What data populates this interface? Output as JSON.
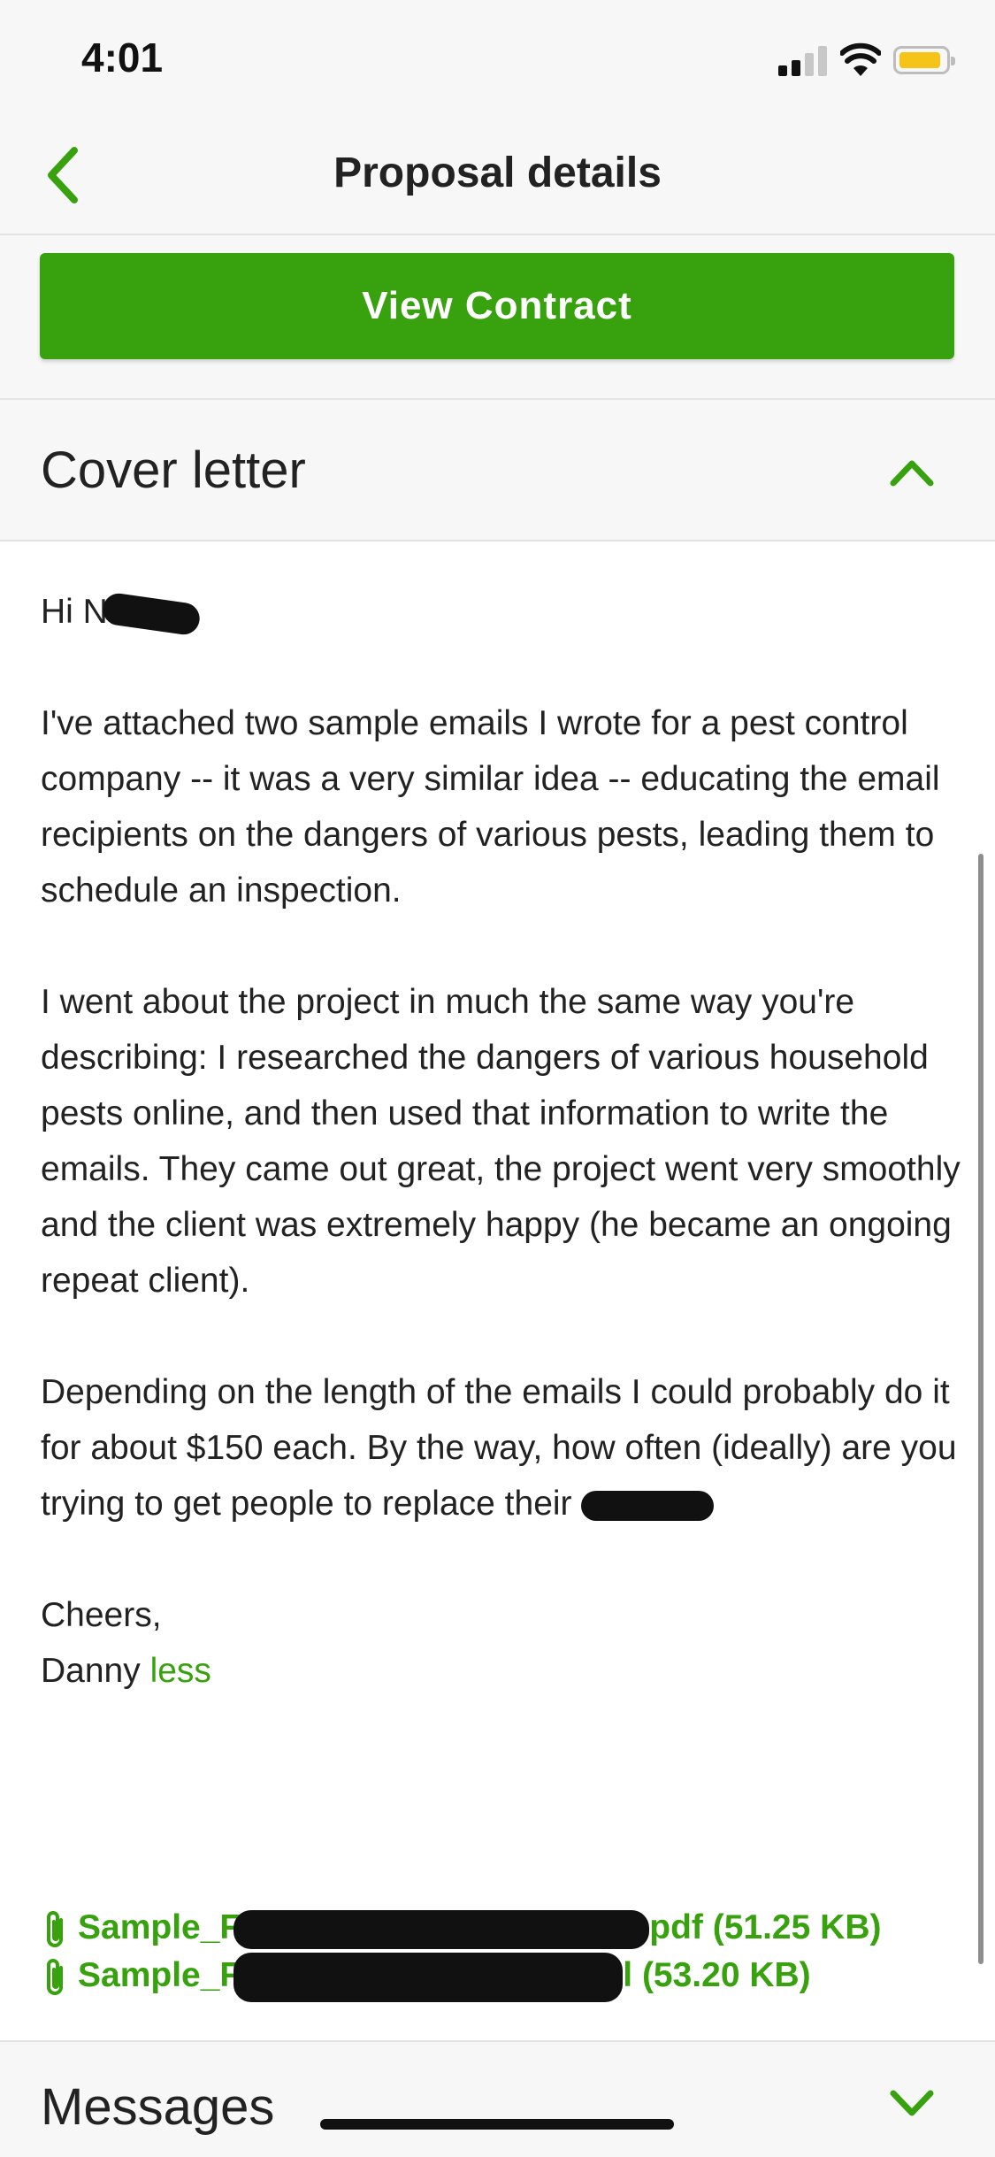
{
  "status_bar": {
    "time": "4:01",
    "icons": [
      "cellular-signal-icon",
      "wifi-icon",
      "battery-icon"
    ]
  },
  "nav": {
    "title": "Proposal details",
    "back_icon": "chevron-left-icon"
  },
  "contract_button": {
    "label": "View Contract"
  },
  "cover_letter": {
    "title": "Cover letter",
    "greeting": "Hi N",
    "paragraph_1": "I've attached two sample emails I wrote for a pest control company -- it was a very similar idea -- educating the email recipients on the dangers of various pests, leading them to schedule an inspection.",
    "paragraph_2": "I went about the project in much the same way you're describing: I researched the dangers of various household pests online, and then used that information to write the emails. They came out great, the project went very smoothly and the client was extremely happy (he became an ongoing repeat client).",
    "paragraph_3": "Depending on the length of the emails I could probably do it for about $150 each. By the way, how often (ideally) are you trying to get people to replace their",
    "sign_off": "Cheers,",
    "signature": "Danny",
    "less_link": "less"
  },
  "attachments": [
    {
      "name_start": "Sample_F",
      "name_end": "pdf",
      "size": "(51.25 KB)"
    },
    {
      "name_start": "Sample_F",
      "name_end": "l",
      "size": "(53.20 KB)"
    }
  ],
  "messages": {
    "title": "Messages"
  },
  "colors": {
    "accent": "#37a10e",
    "background": "#f7f7f7",
    "battery": "#f6c416"
  }
}
